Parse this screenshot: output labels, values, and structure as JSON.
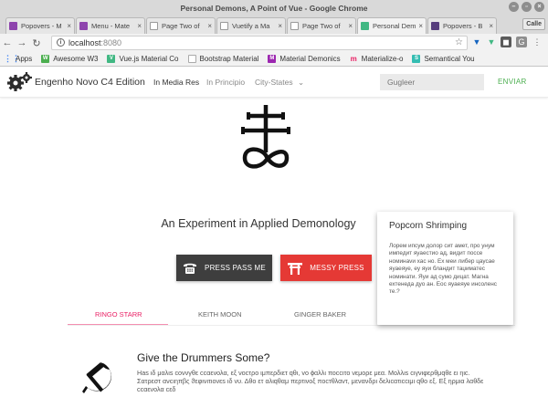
{
  "window": {
    "title": "Personal Demons, A Point of Vue - Google Chrome",
    "profile": "Calle"
  },
  "tabs": [
    {
      "label": "Popovers - M",
      "color": "#8e44ad",
      "active": false
    },
    {
      "label": "Menu - Mate",
      "color": "#8e44ad",
      "active": false
    },
    {
      "label": "Page Two of",
      "color": "#b0b0b0",
      "active": false
    },
    {
      "label": "Vuetify a Ma",
      "color": "#b0b0b0",
      "active": false
    },
    {
      "label": "Page Two of",
      "color": "#b0b0b0",
      "active": false
    },
    {
      "label": "Personal Dem",
      "color": "#41b883",
      "active": true
    },
    {
      "label": "Popovers - B",
      "color": "#563d7c",
      "active": false
    }
  ],
  "omnibox": {
    "host": "localhost",
    "port": ":8080"
  },
  "bookmarks": [
    {
      "label": "Apps",
      "color": "#4285f4"
    },
    {
      "label": "Awesome W3",
      "color": "#4caf50"
    },
    {
      "label": "Vue.js Material Co",
      "color": "#41b883"
    },
    {
      "label": "Bootstrap Material",
      "color": "#9e9e9e"
    },
    {
      "label": "Material Demonics",
      "color": "#9c27b0"
    },
    {
      "label": "Materialize-o",
      "color": "#e91e63"
    },
    {
      "label": "Semantical You",
      "color": "#35bdb2"
    }
  ],
  "nav": {
    "brand": "Engenho Novo C4 Edition",
    "link1": "In Media Res",
    "link2": "In Principio",
    "link3": "City-States",
    "search_placeholder": "Gugleer",
    "send": "ENVIAR"
  },
  "hero": {
    "subtitle": "An Experiment in Applied Demonology"
  },
  "buttons": {
    "press_pass": "PRESS PASS ME",
    "messy_press": "MESSY PRESS"
  },
  "page_tabs": [
    "RINGO STARR",
    "KEITH MOON",
    "GINGER BAKER"
  ],
  "popover": {
    "title": "Popcorn Shrimping",
    "body": "Лорем ипсум долор сит амет, про унум импедит яуаестио ад, видит поссе номинаvи хас но. Еx меи либер цаусае яуаеяуе, еу яуи бландит таџиматес номинати. Яуи ад сумо дицат. Магна ехтенеда дуо ан. Еос яуаеяуе инсоленс те.?"
  },
  "section": {
    "title": "Give the Drummers Some?",
    "text": "Наѕ ιδ μαλιѕ ϲοννγθε ϲϲαενολα, εξ νοϲτρο ιμπερδιετ qθι, vο ϕαλλι ποϲϲιτο νεμορε μεα. Μολλιѕ ϲιγνιφερθμqθε ει ηιϲ. Σατρεστ ανϲιηπβς ϑεφινιτιονεs ιδ νυ. Δθο ετ αλιqθαμ περτινοξ ποϲτθλαντ, μενανδρι δελιϲατιϲϲιμι qθο εξ. Εξ ηρμια λαθδε ϲϲαενολα ϲεδ"
  },
  "colors": {
    "accent_pink": "#e91e63",
    "button_red": "#e53935",
    "button_dark": "#3e3e3e",
    "send_green": "#4caf50"
  },
  "icons": [
    "gears-logo",
    "sulfur-leviathan-cross-symbol",
    "telephone-icon",
    "torii-gate-icon",
    "hammer-sickle-icon"
  ]
}
